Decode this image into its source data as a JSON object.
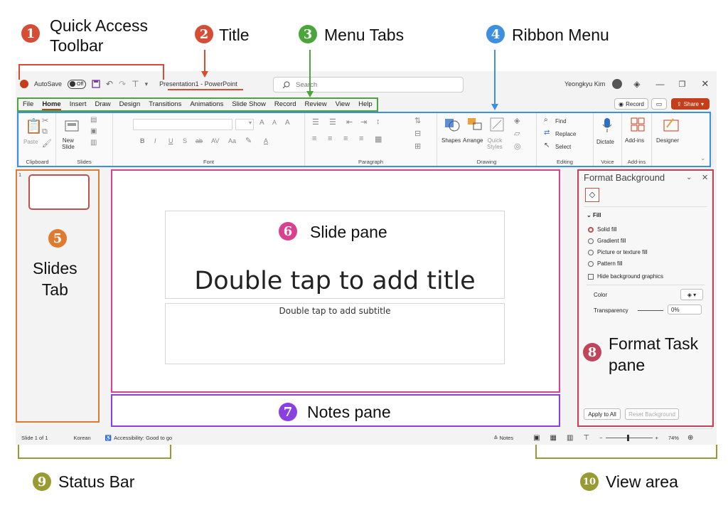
{
  "annotations": {
    "quick_access": {
      "num": "1",
      "label": "Quick Access\nToolbar",
      "color": "#d64d35"
    },
    "title": {
      "num": "2",
      "label": "Title",
      "color": "#d64d35"
    },
    "menu_tabs": {
      "num": "3",
      "label": "Menu Tabs",
      "color": "#4aa63a"
    },
    "ribbon": {
      "num": "4",
      "label": "Ribbon Menu",
      "color": "#3d8fe0"
    },
    "slides_tab": {
      "num": "5",
      "label": "Slides\nTab",
      "color": "#e07a2e"
    },
    "slide_pane": {
      "num": "6",
      "label": "Slide pane",
      "color": "#d9408f"
    },
    "notes_pane": {
      "num": "7",
      "label": "Notes pane",
      "color": "#8a3fe0"
    },
    "format_pane": {
      "num": "8",
      "label": "Format Task\npane",
      "color": "#c0445a"
    },
    "status_bar": {
      "num": "9",
      "label": "Status Bar",
      "color": "#9a9a35"
    },
    "view_area": {
      "num": "10",
      "label": "View area",
      "color": "#9a9a35"
    }
  },
  "titlebar": {
    "autosave": "AutoSave",
    "toggle": "Off",
    "doc_title": "Presentation1  -  PowerPoint",
    "search_placeholder": "Search",
    "user": "Yeongkyu Kim"
  },
  "menu": {
    "tabs": [
      "File",
      "Home",
      "Insert",
      "Draw",
      "Design",
      "Transitions",
      "Animations",
      "Slide Show",
      "Record",
      "Review",
      "View",
      "Help"
    ],
    "record_btn": "Record",
    "share_btn": "Share"
  },
  "ribbon": {
    "groups": [
      "Clipboard",
      "Slides",
      "Font",
      "Paragraph",
      "Drawing",
      "Editing",
      "Voice",
      "Add-ins"
    ],
    "paste": "Paste",
    "new_slide": "New\nSlide",
    "shapes": "Shapes",
    "arrange": "Arrange",
    "quick_styles": "Quick\nStyles",
    "find": "Find",
    "replace": "Replace",
    "select": "Select",
    "dictate": "Dictate",
    "addins": "Add-ins",
    "designer": "Designer"
  },
  "slides": {
    "number": "1"
  },
  "slide": {
    "title_ph": "Double tap to add title",
    "subtitle_ph": "Double tap to add subtitle"
  },
  "format": {
    "title": "Format Background",
    "section": "Fill",
    "options": [
      "Solid fill",
      "Gradient fill",
      "Picture or texture fill",
      "Pattern fill"
    ],
    "hide_bg": "Hide background graphics",
    "color": "Color",
    "transparency": "Transparency",
    "transparency_value": "0%",
    "apply_all": "Apply to All",
    "reset": "Reset Background"
  },
  "status": {
    "slide": "Slide 1 of 1",
    "lang": "Korean",
    "accessibility": "Accessibility: Good to go",
    "notes": "Notes",
    "zoom": "74%"
  }
}
